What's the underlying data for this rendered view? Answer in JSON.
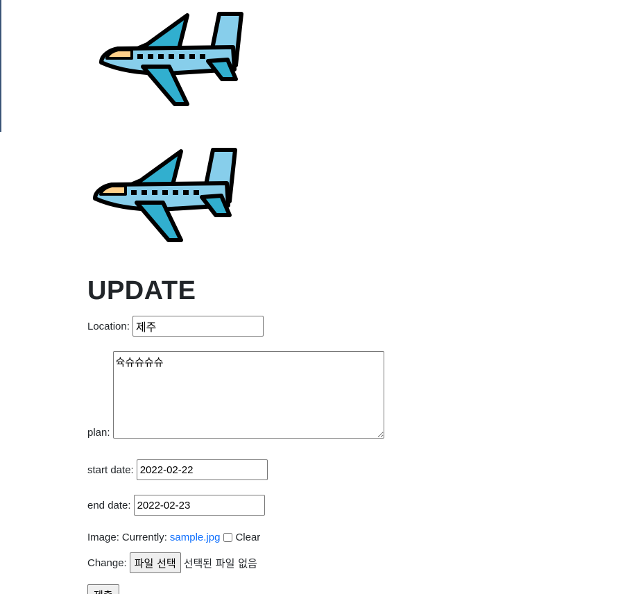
{
  "page_title": "UPDATE",
  "form": {
    "location": {
      "label": "Location:",
      "value": "제주"
    },
    "plan": {
      "label": "plan:",
      "value": "슉슈슈슈슈"
    },
    "start_date": {
      "label": "start date:",
      "value": "2022-02-22"
    },
    "end_date": {
      "label": "end date:",
      "value": "2022-02-23"
    },
    "image": {
      "label": "Image:",
      "currently_label": "Currently:",
      "current_file": "sample.jpg",
      "clear_label": "Clear",
      "change_label": "Change:",
      "choose_file_button": "파일 선택",
      "no_file_text": "선택된 파일 없음"
    },
    "submit_label": "제출"
  },
  "colors": {
    "plane_body": "#87ceeb",
    "plane_wing": "#31afcf",
    "plane_cockpit": "#ffd08a",
    "plane_outline": "#000000",
    "link": "#0d6efd"
  },
  "icons": [
    "airplane-icon",
    "airplane-icon"
  ]
}
